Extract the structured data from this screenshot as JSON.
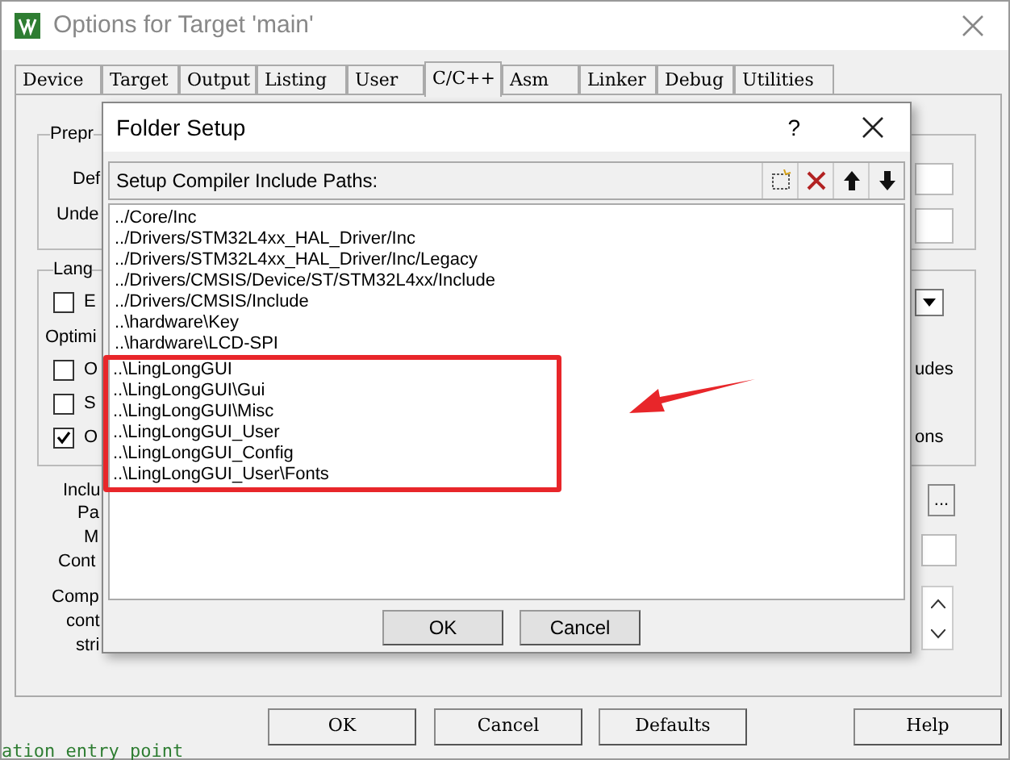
{
  "window": {
    "title": "Options for Target 'main'"
  },
  "tabs": [
    {
      "label": "Device",
      "selected": false
    },
    {
      "label": "Target",
      "selected": false
    },
    {
      "label": "Output",
      "selected": false
    },
    {
      "label": "Listing",
      "selected": false
    },
    {
      "label": "User",
      "selected": false
    },
    {
      "label": "C/C++",
      "selected": true
    },
    {
      "label": "Asm",
      "selected": false
    },
    {
      "label": "Linker",
      "selected": false
    },
    {
      "label": "Debug",
      "selected": false
    },
    {
      "label": "Utilities",
      "selected": false
    }
  ],
  "background_fragments": [
    {
      "kind": "label",
      "text": "Prepr"
    },
    {
      "kind": "label",
      "text": "Def"
    },
    {
      "kind": "label",
      "text": "Unde"
    },
    {
      "kind": "label",
      "text": "Lang"
    },
    {
      "kind": "checkbox",
      "text": "E",
      "checked": false
    },
    {
      "kind": "label",
      "text": "Optimi"
    },
    {
      "kind": "checkbox",
      "text": "O",
      "checked": false
    },
    {
      "kind": "checkbox",
      "text": "S",
      "checked": false
    },
    {
      "kind": "checkbox",
      "text": "O",
      "checked": true
    },
    {
      "kind": "label",
      "text": "Inclu"
    },
    {
      "kind": "label",
      "text": "Pa"
    },
    {
      "kind": "label",
      "text": "M"
    },
    {
      "kind": "label",
      "text": "Cont"
    },
    {
      "kind": "label",
      "text": "Comp"
    },
    {
      "kind": "label",
      "text": "cont"
    },
    {
      "kind": "label",
      "text": "stri"
    },
    {
      "kind": "label",
      "text": "udes"
    },
    {
      "kind": "label",
      "text": "ons"
    },
    {
      "kind": "button",
      "text": "..."
    }
  ],
  "dialog": {
    "title": "Folder Setup",
    "help": "?",
    "list_label": "Setup Compiler Include Paths:",
    "paths": [
      {
        "text": "../Core/Inc",
        "highlighted": false
      },
      {
        "text": "../Drivers/STM32L4xx_HAL_Driver/Inc",
        "highlighted": false
      },
      {
        "text": "../Drivers/STM32L4xx_HAL_Driver/Inc/Legacy",
        "highlighted": false
      },
      {
        "text": "../Drivers/CMSIS/Device/ST/STM32L4xx/Include",
        "highlighted": false
      },
      {
        "text": "../Drivers/CMSIS/Include",
        "highlighted": false
      },
      {
        "text": "..\\hardware\\Key",
        "highlighted": false
      },
      {
        "text": "..\\hardware\\LCD-SPI",
        "highlighted": false
      },
      {
        "text": "..\\LingLongGUI",
        "highlighted": true
      },
      {
        "text": "..\\LingLongGUI\\Gui",
        "highlighted": true
      },
      {
        "text": "..\\LingLongGUI\\Misc",
        "highlighted": true
      },
      {
        "text": "..\\LingLongGUI_User",
        "highlighted": true
      },
      {
        "text": "..\\LingLongGUI_Config",
        "highlighted": true
      },
      {
        "text": "..\\LingLongGUI_User\\Fonts",
        "highlighted": true
      }
    ],
    "buttons": [
      "OK",
      "Cancel"
    ]
  },
  "buttons": [
    "OK",
    "Cancel",
    "Defaults",
    "Help"
  ],
  "status_text": "ation entry point"
}
